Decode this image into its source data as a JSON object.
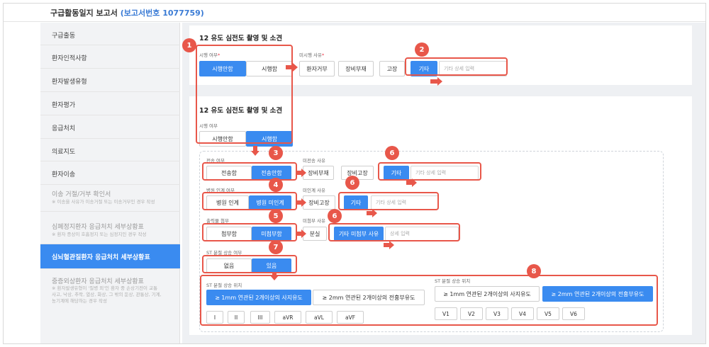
{
  "header": {
    "title": "구급활동일지 보고서",
    "report_no": "(보고서번호 1077759)"
  },
  "sidebar": {
    "items": [
      {
        "label": "구급출동"
      },
      {
        "label": "환자인적사항"
      },
      {
        "label": "환자발생유형"
      },
      {
        "label": "환자평가"
      },
      {
        "label": "응급처치"
      },
      {
        "label": "의료지도"
      },
      {
        "label": "환자이송"
      },
      {
        "label": "이송 거절/거부 확인서",
        "sub": "※ 이송을 사유가 이송거절 또는 이송거부인 경우 작성"
      },
      {
        "label": "심폐정지환자 응급처치 세부상황표",
        "sub": "※ 환자 증상이 호흡정지 또는 심정지인 경우 작성"
      },
      {
        "label": "심뇌혈관질환자 응급처치 세부상황표"
      },
      {
        "label": "중증외상환자 응급처치 세부상황표",
        "sub1": "※ 환자발생유형이 '질병 외'인 환자 중 손상기전이 교통",
        "sub2": "사고, 낙상, 추락, 열상, 화상, 그 밖의 둔상, 관통상, 기계,",
        "sub3": "농기계에 해당하는 경우 작성"
      }
    ]
  },
  "section1": {
    "title": "12 유도 심전도 촬영 및 소견",
    "label": "시행 여부",
    "required_mark": "*",
    "options": [
      "시행안함",
      "시행함"
    ],
    "reason_label": "미시행 사유",
    "reasons": [
      "환자거부",
      "장비부재",
      "고장",
      "기타"
    ],
    "detail_placeholder": "기타 상세 입력"
  },
  "section2": {
    "title": "12 유도 심전도 촬영 및 소견",
    "label": "시행 여부",
    "options": [
      "시행안함",
      "시행함"
    ],
    "transmit_label": "전송 여부",
    "transmit": [
      "전송함",
      "전송안함"
    ],
    "notransmit_label": "미전송 사유",
    "notransmit": [
      "장비부재",
      "장비고장",
      "기타"
    ],
    "handover_label": "병원 인계 여부",
    "handover": [
      "병원 인계",
      "병원 미인계"
    ],
    "nohandover_label": "미인계 사유",
    "nohandover": [
      "장비고장",
      "기타"
    ],
    "attach_label": "출력물 첨부",
    "attach": [
      "첨부함",
      "미첨부함"
    ],
    "noattach_label": "미첨부 사유",
    "noattach": [
      "분실",
      "기타 미첨부 사유"
    ],
    "detail_placeholder": "기타 상세 입력",
    "detail_placeholder2": "상세 입력",
    "st_label": "ST 분절 상승 여부",
    "st": [
      "없음",
      "있음"
    ],
    "st_pos_label": "ST 분절 상승 위치",
    "st_pos": [
      "≥ 1mm 연관된 2개이상의 사지유도",
      "≥ 2mm 연관된 2개이상의 전흉부유도"
    ],
    "limb_leads": [
      "I",
      "II",
      "III",
      "aVR",
      "aVL",
      "aVF"
    ],
    "chest_leads": [
      "V1",
      "V2",
      "V3",
      "V4",
      "V5",
      "V6"
    ]
  },
  "badges": [
    "1",
    "2",
    "3",
    "4",
    "5",
    "6",
    "7",
    "8"
  ],
  "colors": {
    "accent": "#3a8bf0",
    "highlight": "#e8574a"
  }
}
